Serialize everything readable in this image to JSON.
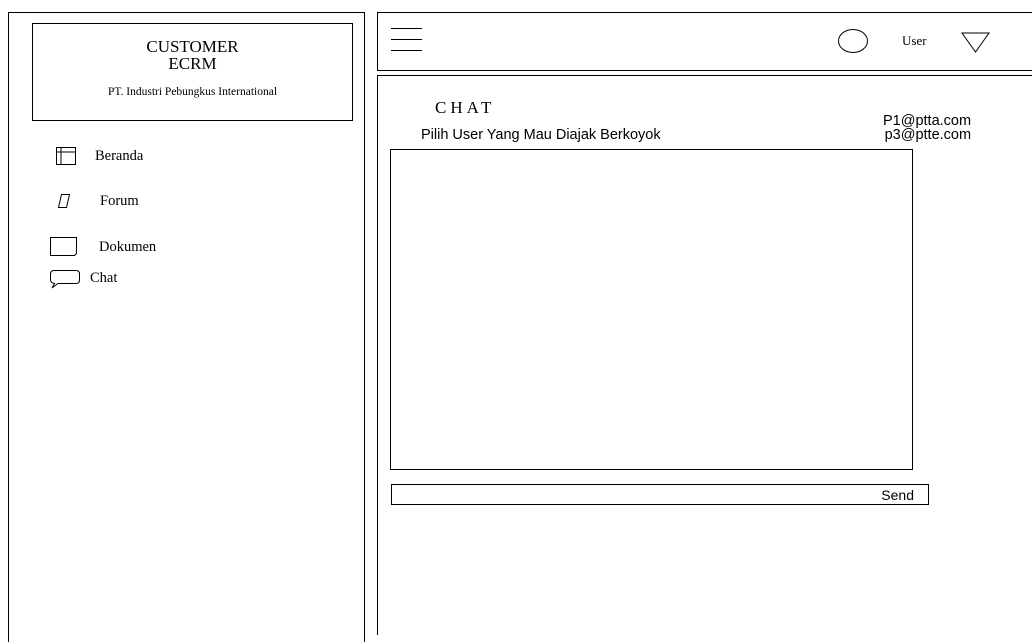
{
  "brand": {
    "title": "CUSTOMER\nECRM",
    "subtitle": "PT. Industri Pebungkus International"
  },
  "sidebar": {
    "items": [
      {
        "label": "Beranda",
        "icon": "home-panel-icon"
      },
      {
        "label": "Forum",
        "icon": "forum-icon"
      },
      {
        "label": "Dokumen",
        "icon": "document-icon"
      },
      {
        "label": "Chat",
        "icon": "chat-bubble-icon"
      }
    ]
  },
  "topbar": {
    "menu_icon": "hamburger-icon",
    "avatar_icon": "user-circle-icon",
    "user_label": "User",
    "dropdown_icon": "triangle-down-icon"
  },
  "chat": {
    "title": "CHAT",
    "instruction": "Pilih User Yang Mau Diajak Berkoyok",
    "users": [
      "P1@ptta.com",
      "p3@ptte.com"
    ],
    "message_value": "",
    "send_label": "Send"
  }
}
